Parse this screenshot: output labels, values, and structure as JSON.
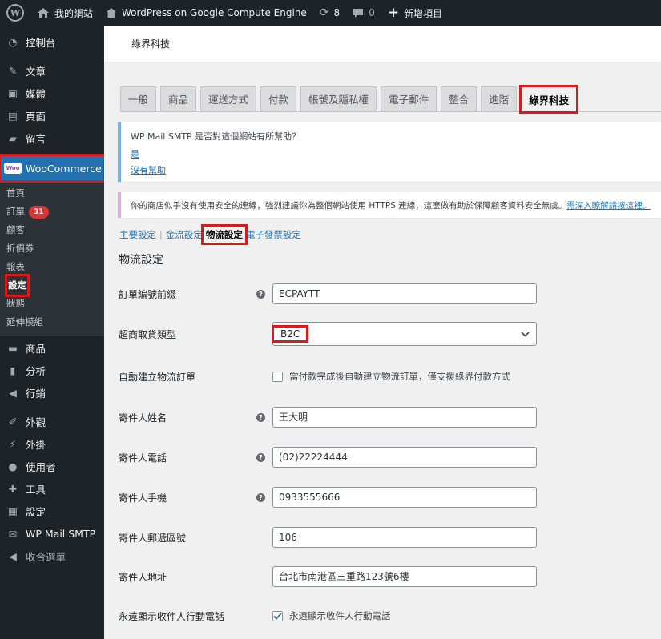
{
  "admin_bar": {
    "site_name": "我的網站",
    "page_name": "WordPress on Google Compute Engine",
    "updates_count": "8",
    "comments_count": "0",
    "new_item": "新增項目"
  },
  "sidebar": {
    "dashboard": "控制台",
    "posts": "文章",
    "media": "媒體",
    "pages": "頁面",
    "comments": "留言",
    "woocommerce": "WooCommerce",
    "woo_logo": "Woo",
    "submenu": {
      "home": "首頁",
      "orders": "訂單",
      "orders_badge": "31",
      "customers": "顧客",
      "coupons": "折價券",
      "reports": "報表",
      "settings": "設定",
      "status": "狀態",
      "extensions": "延伸模組"
    },
    "products": "商品",
    "analytics": "分析",
    "marketing": "行銷",
    "appearance": "外觀",
    "plugins": "外掛",
    "users": "使用者",
    "tools": "工具",
    "settings": "設定",
    "wp_mail_smtp": "WP Mail SMTP",
    "collapse": "收合選單"
  },
  "header": {
    "company": "綠界科技"
  },
  "tabs": [
    "一般",
    "商品",
    "運送方式",
    "付款",
    "帳號及隱私權",
    "電子郵件",
    "整合",
    "進階",
    "綠界科技"
  ],
  "notice_smtp": {
    "text": "WP Mail SMTP 是否對這個網站有所幫助？",
    "yes": "是",
    "no": "沒有幫助"
  },
  "notice_https": {
    "text": "你的商店似乎沒有使用安全的連線，強烈建議你為整個網站使用 HTTPS 連線，這麼做有助於保障顧客資料安全無虞。",
    "link": "需深入瞭解請按這裡。"
  },
  "subsubsub": {
    "main": "主要設定",
    "payment": "金流設定",
    "logistics": "物流設定",
    "invoice": "電子發票設定",
    "separator": "|"
  },
  "section_title": "物流設定",
  "help_glyph": "?",
  "fields": {
    "order_prefix": {
      "label": "訂單編號前綴",
      "value": "ECPAYTT"
    },
    "cvs_type": {
      "label": "超商取貨類型",
      "value": "B2C"
    },
    "auto_order": {
      "label": "自動建立物流訂單",
      "text": "當付款完成後自動建立物流訂單，僅支援綠界付款方式"
    },
    "sender_name": {
      "label": "寄件人姓名",
      "value": "王大明"
    },
    "sender_phone": {
      "label": "寄件人電話",
      "value": "(02)22224444"
    },
    "sender_mobile": {
      "label": "寄件人手機",
      "value": "0933555666"
    },
    "sender_zip": {
      "label": "寄件人郵遞區號",
      "value": "106"
    },
    "sender_address": {
      "label": "寄件人地址",
      "value": "台北市南港區三重路123號6樓"
    },
    "always_show_phone": {
      "label": "永遠顯示收件人行動電話",
      "text": "永遠顯示收件人行動電話"
    }
  }
}
